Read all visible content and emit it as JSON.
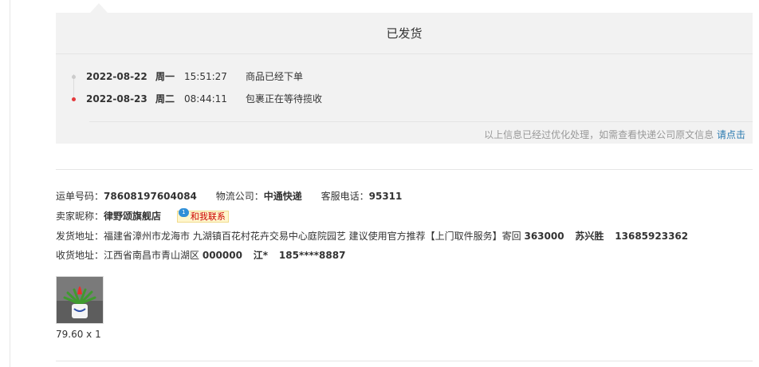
{
  "status": {
    "title": "已发货",
    "timeline": [
      {
        "date": "2022-08-22",
        "weekday": "周一",
        "time": "15:51:27",
        "desc": "商品已经下单",
        "color": "#cccccc"
      },
      {
        "date": "2022-08-23",
        "weekday": "周二",
        "time": "08:44:11",
        "desc": "包裹正在等待揽收",
        "color": "#e4393c"
      }
    ],
    "note": "以上信息已经过优化处理，如需查看快递公司原文信息",
    "note_link": "请点击"
  },
  "shipment": {
    "tracking_label": "运单号码：",
    "tracking_no": "78608197604084",
    "carrier_label": "物流公司：",
    "carrier": "中通快递",
    "service_label": "客服电话：",
    "service_phone": "95311"
  },
  "seller": {
    "label": "卖家昵称：",
    "name": "律野颂旗舰店",
    "contact_badge": "1",
    "contact_text": "和我联系"
  },
  "ship_from": {
    "label": "发货地址：",
    "address": "福建省漳州市龙海市 九湖镇百花村花卉交易中心庭院园艺 建议使用官方推荐【上门取件服务】寄回",
    "zip": "363000",
    "name": "苏兴胜",
    "phone": "13685923362"
  },
  "ship_to": {
    "label": "收货地址：",
    "address": "江西省南昌市青山湖区",
    "zip": "000000",
    "name": "江*",
    "phone": "185****8887"
  },
  "product": {
    "price_qty": "79.60 x 1"
  }
}
